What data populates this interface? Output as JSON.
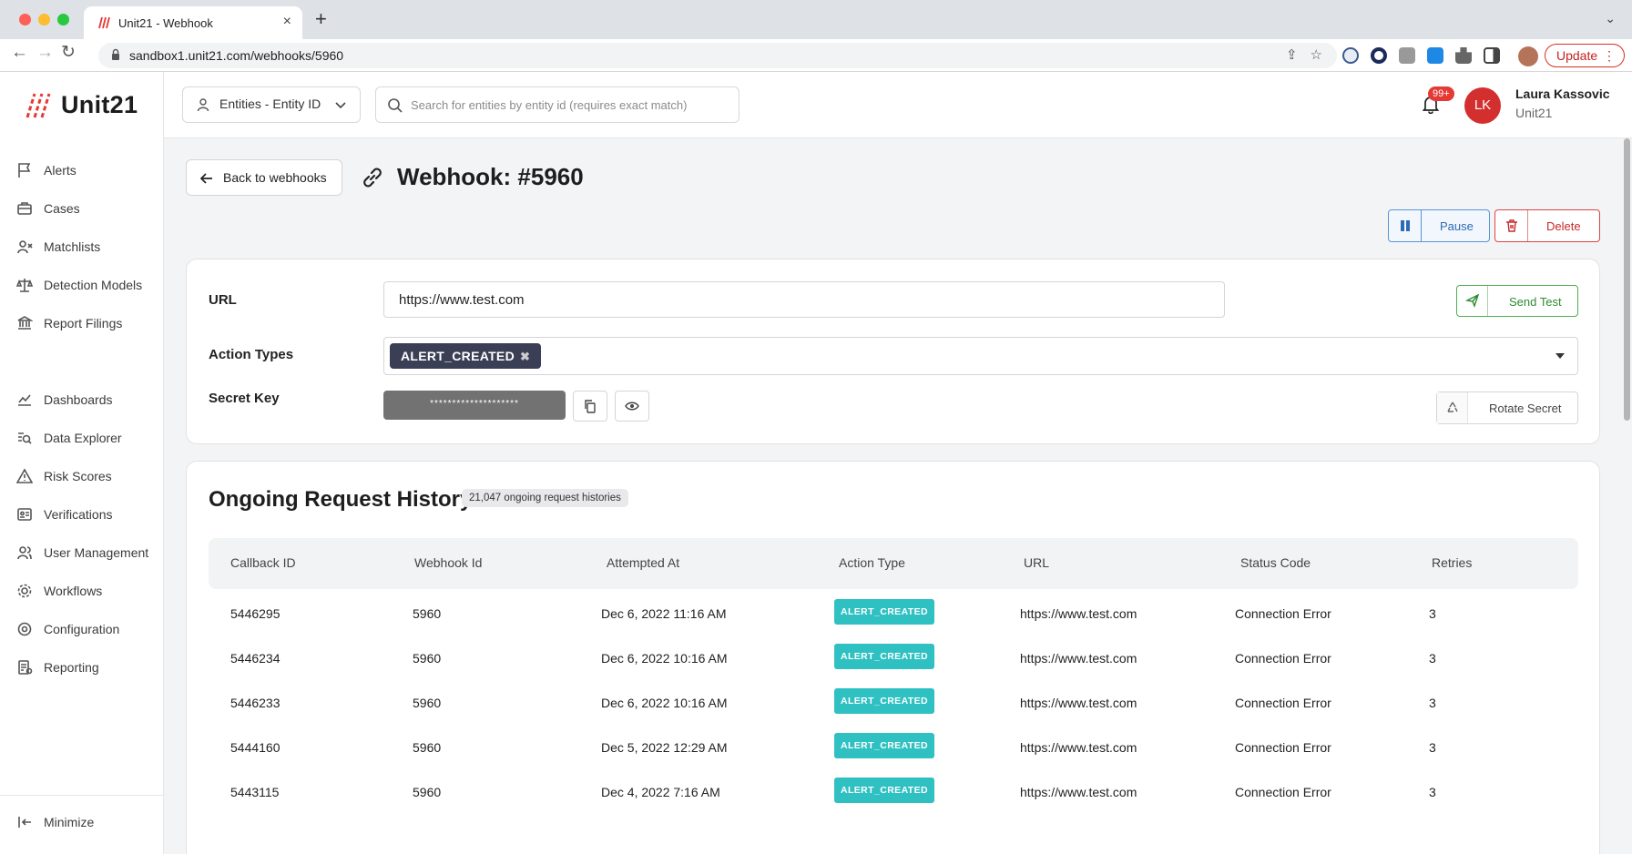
{
  "browser": {
    "tab_title": "Unit21 - Webhook",
    "url": "sandbox1.unit21.com/webhooks/5960",
    "update_label": "Update"
  },
  "sidebar": {
    "logo_text": "Unit21",
    "items": [
      {
        "label": "Alerts",
        "icon": "flag-icon"
      },
      {
        "label": "Cases",
        "icon": "briefcase-icon"
      },
      {
        "label": "Matchlists",
        "icon": "user-x-icon"
      },
      {
        "label": "Detection Models",
        "icon": "scale-icon"
      },
      {
        "label": "Report Filings",
        "icon": "bank-icon"
      },
      {
        "label": "Dashboards",
        "icon": "chart-line-icon"
      },
      {
        "label": "Data Explorer",
        "icon": "data-search-icon"
      },
      {
        "label": "Risk Scores",
        "icon": "warning-icon"
      },
      {
        "label": "Verifications",
        "icon": "id-card-icon"
      },
      {
        "label": "User Management",
        "icon": "users-icon"
      },
      {
        "label": "Workflows",
        "icon": "workflow-gear-icon"
      },
      {
        "label": "Configuration",
        "icon": "gear-icon"
      },
      {
        "label": "Reporting",
        "icon": "report-icon"
      }
    ],
    "minimize_label": "Minimize"
  },
  "topbar": {
    "entity_select_label": "Entities - Entity ID",
    "search_placeholder": "Search for entities by entity id (requires exact match)",
    "notification_count": "99+",
    "user_initials": "LK",
    "user_name": "Laura Kassovic",
    "user_org": "Unit21"
  },
  "page": {
    "back_label": "Back to webhooks",
    "title": "Webhook: #5960",
    "pause_label": "Pause",
    "delete_label": "Delete"
  },
  "config": {
    "url_label": "URL",
    "url_value": "https://www.test.com",
    "send_test_label": "Send Test",
    "action_types_label": "Action Types",
    "action_types": [
      "ALERT_CREATED"
    ],
    "secret_key_label": "Secret Key",
    "secret_key_masked": "********************",
    "rotate_label": "Rotate Secret"
  },
  "history": {
    "title": "Ongoing Request History",
    "count_badge": "21,047 ongoing request histories",
    "columns": [
      "Callback ID",
      "Webhook Id",
      "Attempted At",
      "Action Type",
      "URL",
      "Status Code",
      "Retries"
    ],
    "rows": [
      {
        "callback_id": "5446295",
        "webhook_id": "5960",
        "attempted_at": "Dec 6, 2022 11:16 AM",
        "action_type": "ALERT_CREATED",
        "url": "https://www.test.com",
        "status": "Connection Error",
        "retries": "3"
      },
      {
        "callback_id": "5446234",
        "webhook_id": "5960",
        "attempted_at": "Dec 6, 2022 10:16 AM",
        "action_type": "ALERT_CREATED",
        "url": "https://www.test.com",
        "status": "Connection Error",
        "retries": "3"
      },
      {
        "callback_id": "5446233",
        "webhook_id": "5960",
        "attempted_at": "Dec 6, 2022 10:16 AM",
        "action_type": "ALERT_CREATED",
        "url": "https://www.test.com",
        "status": "Connection Error",
        "retries": "3"
      },
      {
        "callback_id": "5444160",
        "webhook_id": "5960",
        "attempted_at": "Dec 5, 2022 12:29 AM",
        "action_type": "ALERT_CREATED",
        "url": "https://www.test.com",
        "status": "Connection Error",
        "retries": "3"
      },
      {
        "callback_id": "5443115",
        "webhook_id": "5960",
        "attempted_at": "Dec 4, 2022 7:16 AM",
        "action_type": "ALERT_CREATED",
        "url": "https://www.test.com",
        "status": "Connection Error",
        "retries": "3"
      }
    ]
  },
  "colors": {
    "brand_red": "#e53935",
    "action_badge": "#2fc0c2",
    "chip_dark": "#3a3f55",
    "pause_blue": "#2d6bb5",
    "send_green": "#2e8b32"
  }
}
